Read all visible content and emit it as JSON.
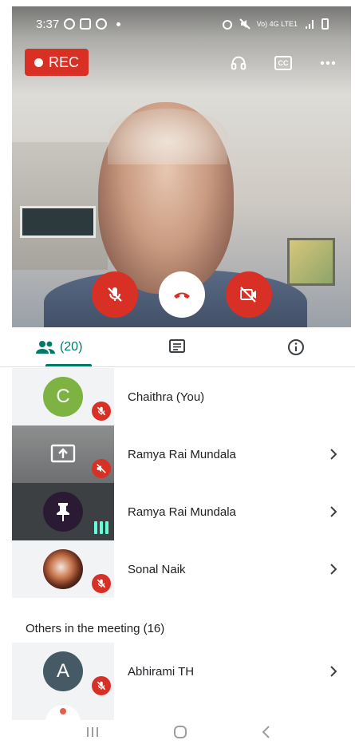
{
  "status_bar": {
    "time": "3:37",
    "network_text": "Vo) 4G LTE1"
  },
  "video": {
    "rec_label": "REC",
    "top_icons": [
      "headphones-icon",
      "closed-captions-icon",
      "more-options-icon"
    ],
    "cc_label": "CC",
    "controls": [
      "mic-off-icon",
      "end-call-icon",
      "camera-off-icon"
    ]
  },
  "tabs": {
    "people_count": "(20)",
    "items": [
      "people-icon",
      "chat-icon",
      "info-icon"
    ]
  },
  "participants": [
    {
      "name": "Chaithra (You)",
      "avatar_letter": "C",
      "avatar_color": "#7cb342",
      "muted": true
    },
    {
      "name": "Ramya Rai Mundala",
      "tile": "screen-share",
      "muted": true
    },
    {
      "name": "Ramya Rai Mundala",
      "tile": "pinned-speaking",
      "muted": false
    },
    {
      "name": "Sonal Naik",
      "tile": "photo",
      "muted": true
    }
  ],
  "others": {
    "title": "Others in the meeting (16)",
    "items": [
      {
        "name": "Abhirami TH",
        "avatar_letter": "A",
        "avatar_color": "#455a64",
        "muted": true
      }
    ]
  },
  "colors": {
    "accent": "#00796b",
    "danger": "#d93025",
    "speaking": "#64ffda"
  }
}
